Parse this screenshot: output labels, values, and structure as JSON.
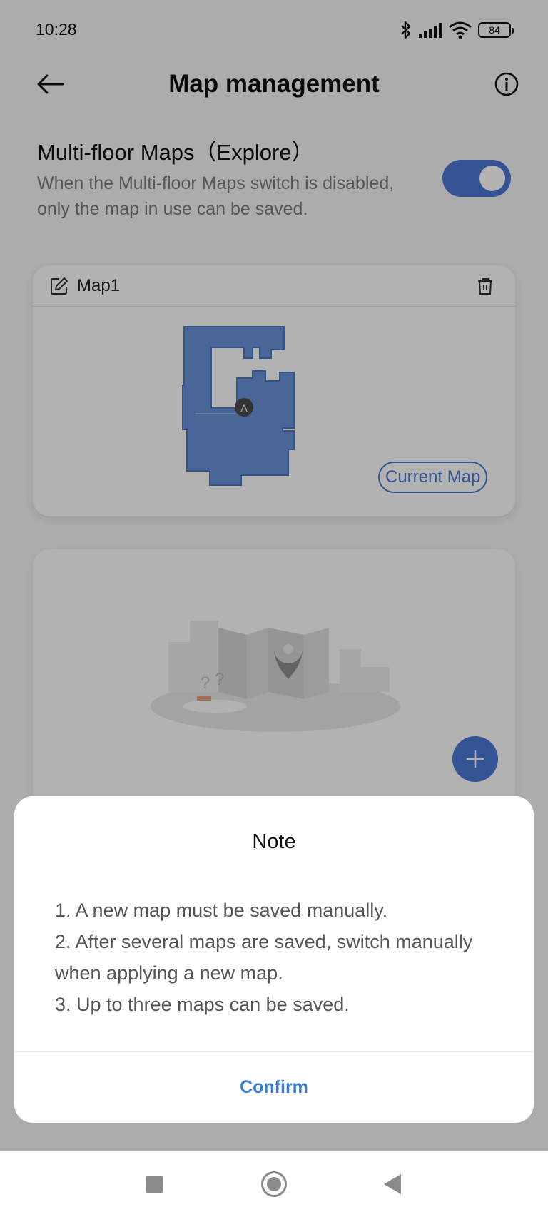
{
  "status_bar": {
    "time": "10:28",
    "battery_level": "84",
    "icons": [
      "bluetooth-icon",
      "signal-icon",
      "wifi-icon",
      "battery-icon"
    ]
  },
  "header": {
    "title": "Map management",
    "back_icon": "arrow-left-icon",
    "info_icon": "info-icon"
  },
  "setting": {
    "title": "Multi-floor Maps（Explore）",
    "description": "When the Multi-floor Maps switch is disabled, only the map in use can be saved.",
    "enabled": true
  },
  "map_card": {
    "name": "Map1",
    "current_badge": "Current Map",
    "marker_label": "A",
    "edit_icon": "edit-icon",
    "delete_icon": "trash-icon"
  },
  "add_card": {
    "illustration": "empty-map-illustration",
    "add_icon": "plus-icon"
  },
  "dialog": {
    "title": "Note",
    "lines": [
      "1. A new map must be saved manually.",
      "2. After several maps are saved, switch manually when applying a new map.",
      "3. Up to three maps can be saved."
    ],
    "confirm_label": "Confirm"
  },
  "colors": {
    "accent": "#4b78d6",
    "confirm": "#3a7cd6",
    "map_fill": "#6a91d9"
  }
}
